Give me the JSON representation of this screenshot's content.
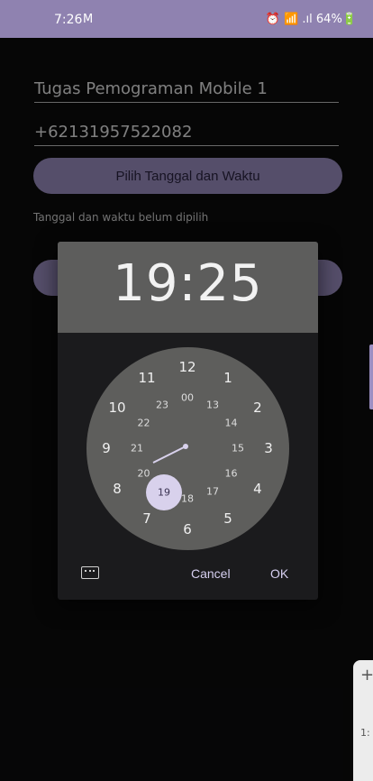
{
  "status_bar": {
    "time": "7:26",
    "mail_icon": "M",
    "right": "⏰ 📶 .ıl 64%🔋"
  },
  "form": {
    "title_field": "Tugas Pemograman Mobile 1",
    "phone_field": "+62131957522082",
    "pick_button_label": "Pilih Tanggal dan Waktu",
    "status_text": "Tanggal dan waktu belum dipilih"
  },
  "time_picker": {
    "time": "19:25",
    "selected_hour": "19",
    "outer_hours": [
      "12",
      "1",
      "2",
      "3",
      "4",
      "5",
      "6",
      "7",
      "8",
      "9",
      "10",
      "11"
    ],
    "inner_hours": [
      "00",
      "13",
      "14",
      "15",
      "16",
      "17",
      "18",
      "19",
      "20",
      "21",
      "22",
      "23"
    ],
    "cancel_label": "Cancel",
    "ok_label": "OK",
    "accent_color": "#d8d1ec",
    "keyboard_icon": "keyboard-icon"
  },
  "side_panel": {
    "plus": "+",
    "text": "1:"
  }
}
